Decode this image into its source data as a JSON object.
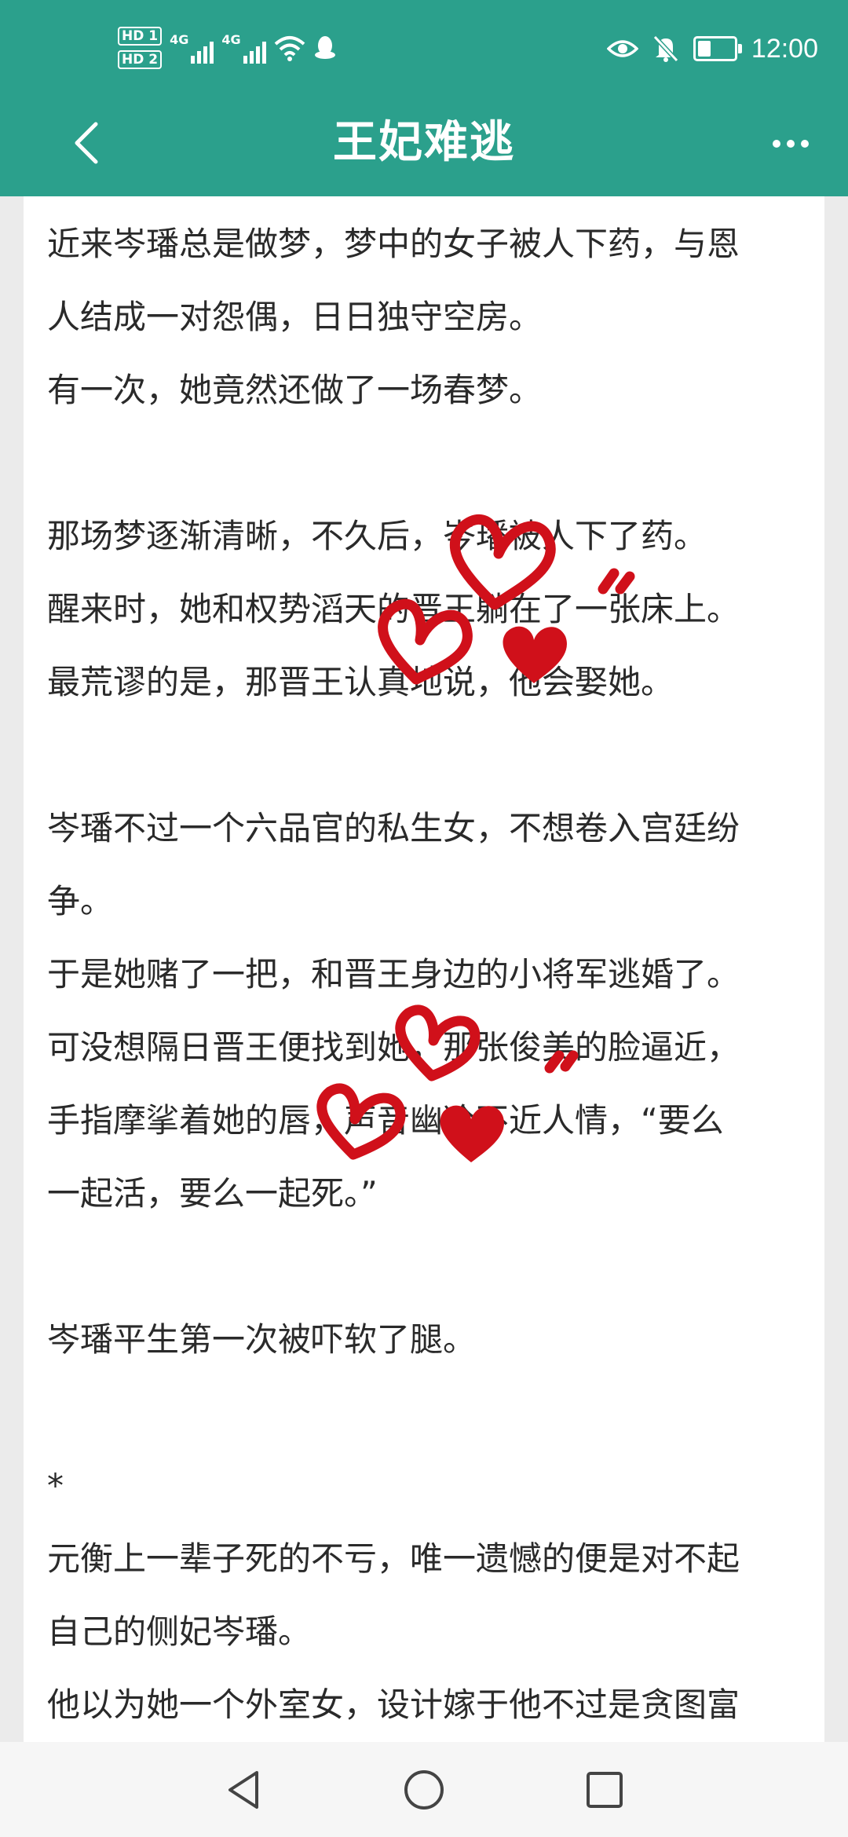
{
  "status_bar": {
    "hd1": "HD 1",
    "hd2": "HD 2",
    "net1": "4G",
    "net2": "4G",
    "time": "12:00",
    "icons": [
      "wifi-icon",
      "qq-penguin-icon",
      "eye-icon",
      "bell-off-icon",
      "battery-icon"
    ]
  },
  "app_bar": {
    "title": "王妃难逃",
    "back_icon": "chevron-left-icon",
    "more_icon": "more-dots-icon"
  },
  "content": {
    "lines": [
      "近来岑璠总是做梦，梦中的女子被人下药，与恩",
      "人结成一对怨偶，日日独守空房。",
      "有一次，她竟然还做了一场春梦。",
      "",
      "那场梦逐渐清晰，不久后，岑璠被人下了药。",
      "醒来时，她和权势滔天的晋王躺在了一张床上。",
      "最荒谬的是，那晋王认真地说，他会娶她。",
      "",
      "岑璠不过一个六品官的私生女，不想卷入宫廷纷",
      "争。",
      "于是她赌了一把，和晋王身边的小将军逃婚了。",
      "可没想隔日晋王便找到她，那张俊美的脸逼近，",
      "手指摩挲着她的唇，声音幽冷不近人情，“要么",
      "一起活，要么一起死。”",
      "",
      "岑璠平生第一次被吓软了腿。",
      "",
      "*",
      "元衡上一辈子死的不亏，唯一遗憾的便是对不起",
      "自己的侧妃岑璠。",
      "他以为她一个外室女，设计嫁于他不过是贪图富"
    ]
  },
  "decorations": {
    "heart_color": "#d0101a"
  },
  "nav_bar": {
    "back": "triangle-back-icon",
    "home": "circle-home-icon",
    "recents": "square-recents-icon"
  }
}
